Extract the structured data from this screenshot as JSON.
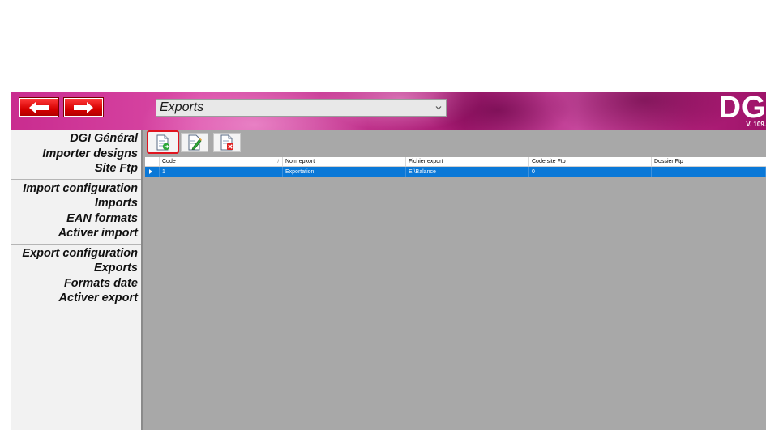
{
  "header": {
    "brand": "DGI",
    "version": "V. 109.",
    "module_select": {
      "value": "Exports"
    },
    "colors": {
      "band": "#c92c8f",
      "nav_button": "#d60000"
    }
  },
  "nav": {
    "back_icon": "arrow-left-icon",
    "forward_icon": "arrow-right-icon"
  },
  "sidebar": {
    "groups": [
      {
        "items": [
          "DGI Général",
          "Importer designs",
          "Site Ftp"
        ]
      },
      {
        "items": [
          "Import configuration",
          "Imports",
          "EAN formats",
          "Activer import"
        ]
      },
      {
        "items": [
          "Export configuration",
          "Exports",
          "Formats date",
          "Activer export"
        ]
      }
    ]
  },
  "toolbar": {
    "add_icon": "new-document-icon",
    "edit_icon": "edit-document-icon",
    "delete_icon": "delete-document-icon"
  },
  "grid": {
    "columns": [
      "Code",
      "Nom epxort",
      "Fichier export",
      "Code site Ftp",
      "Dossier Ftp"
    ],
    "rows": [
      {
        "code": "1",
        "nom": "Exportation",
        "fichier": "E:\\Balance",
        "code_site": "0",
        "dossier": ""
      }
    ],
    "colors": {
      "selected_row": "#0a78d7"
    }
  }
}
